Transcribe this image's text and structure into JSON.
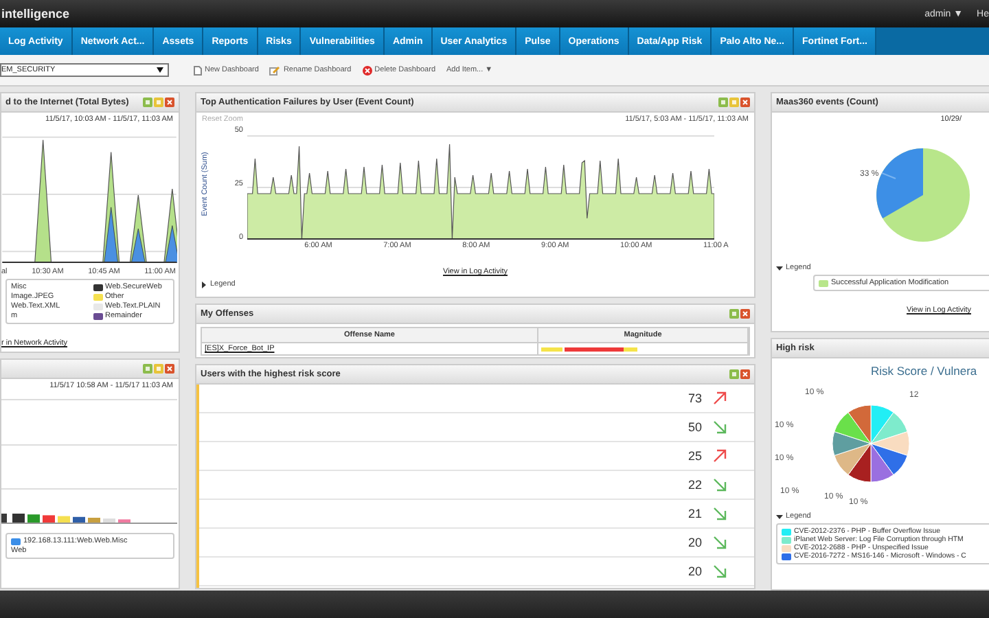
{
  "header": {
    "brand": "intelligence",
    "user": "admin ▼",
    "help": "He"
  },
  "nav": [
    {
      "label": "Log Activity"
    },
    {
      "label": "Network Act..."
    },
    {
      "label": "Assets"
    },
    {
      "label": "Reports"
    },
    {
      "label": "Risks"
    },
    {
      "label": "Vulnerabilities"
    },
    {
      "label": "Admin"
    },
    {
      "label": "User Analytics"
    },
    {
      "label": "Pulse"
    },
    {
      "label": "Operations"
    },
    {
      "label": "Data/App Risk"
    },
    {
      "label": "Palo Alto Ne..."
    },
    {
      "label": "Fortinet Fort..."
    }
  ],
  "toolbar": {
    "dashboard": "EM_SECURITY",
    "actions": [
      {
        "kind": "new",
        "label": "New Dashboard"
      },
      {
        "kind": "rename",
        "label": "Rename Dashboard"
      },
      {
        "kind": "delete",
        "label": "Delete Dashboard"
      },
      {
        "kind": "add",
        "label": "Add Item... ▼"
      }
    ]
  },
  "traffic": {
    "title": "d to the Internet (Total Bytes)",
    "settings_button": true,
    "range": "11/5/17, 10:03 AM - 11/5/17, 11:03 AM",
    "xticks": [
      "al",
      "10:30 AM",
      "10:45 AM",
      "11:00 AM"
    ],
    "legend": [
      {
        "label": "Misc"
      },
      {
        "label": "Web.SecureWeb",
        "color": "#333333"
      },
      {
        "label": "Image.JPEG"
      },
      {
        "label": "Other",
        "color": "#f5e050"
      },
      {
        "label": "Web.Text.XML"
      },
      {
        "label": "Web.Text.PLAIN",
        "color": "#e8e8e8"
      },
      {
        "label": "m"
      },
      {
        "label": "Remainder",
        "color": "#6a4c93"
      }
    ],
    "link": "r in Network Activity"
  },
  "hosts": {
    "settings_button": true,
    "range": "11/5/17 10:58 AM - 11/5/17 11:03 AM",
    "legend": [
      {
        "label": "192.168.13.111:Web.Web.Misc",
        "color": "#3b8ee8"
      },
      {
        "label": "Web"
      }
    ]
  },
  "auth": {
    "title": "Top Authentication Failures by User (Event Count)",
    "settings_button": true,
    "reset": "Reset Zoom",
    "range": "11/5/17, 5:03 AM - 11/5/17, 11:03 AM",
    "ylabel": "Event Count (Sum)",
    "yticks": [
      "50",
      "25",
      "0"
    ],
    "xticks": [
      "6:00 AM",
      "7:00 AM",
      "8:00 AM",
      "9:00 AM",
      "10:00 AM",
      "11:00 A"
    ],
    "link": "View in Log Activity",
    "legend": "Legend",
    "legend_expanded": false
  },
  "offenses": {
    "title": "My Offenses",
    "settings_button": false,
    "columns": [
      "Offense Name",
      "Magnitude"
    ],
    "rows": [
      {
        "name": "[ES]X_Force_Bot_IP",
        "level": 0.47
      }
    ]
  },
  "risk_users": {
    "title": "Users with the highest risk score",
    "settings_button": false,
    "rows": [
      {
        "score": "73",
        "kind": "up"
      },
      {
        "score": "50",
        "kind": "down"
      },
      {
        "score": "25",
        "kind": "up"
      },
      {
        "score": "22",
        "kind": "down"
      },
      {
        "score": "21",
        "kind": "down"
      },
      {
        "score": "20",
        "kind": "down"
      },
      {
        "score": "20",
        "kind": "down"
      }
    ]
  },
  "maas": {
    "title": "Maas360 events (Count)",
    "range": "10/29/",
    "slice_label": "33 %",
    "legend": "Legend",
    "legend_expanded": true,
    "items": [
      {
        "label": "Successful Application Modification",
        "color": "#b8e68a"
      }
    ],
    "link": "View in Log Activity"
  },
  "high_risk": {
    "title": "High risk",
    "chart_title": "Risk Score / Vulnera",
    "slice_labels": [
      "12",
      "10 %",
      "10 %",
      "10 %",
      "10 %",
      "10 %",
      "10 %"
    ],
    "legend": "Legend",
    "legend_expanded": true,
    "items": [
      {
        "label": "CVE-2012-2376 - PHP - Buffer Overflow Issue",
        "color": "#22eef5"
      },
      {
        "label": "iPlanet Web Server: Log File Corruption through HTM",
        "color": "#7eebcc"
      },
      {
        "label": "CVE-2012-2688 - PHP - Unspecified Issue",
        "color": "#f9dcc0"
      },
      {
        "label": "CVE-2016-7272 - MS16-146 - Microsoft - Windows - C",
        "color": "#2f6fe8"
      }
    ]
  }
}
